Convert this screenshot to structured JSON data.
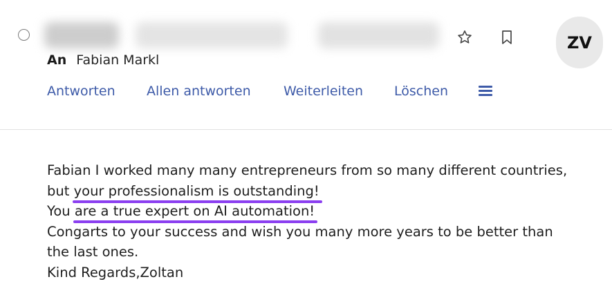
{
  "message": {
    "to_label": "An",
    "to_name": "Fabian Markl",
    "avatar_initials": "ZV",
    "icons": {
      "select": "select-circle-icon",
      "flag": "star-icon",
      "bookmark": "bookmark-icon",
      "more": "menu-icon"
    }
  },
  "actions": {
    "reply": "Antworten",
    "reply_all": "Allen antworten",
    "forward": "Weiterleiten",
    "delete": "Löschen"
  },
  "body": {
    "line1": "Fabian I worked many many entrepreneurs from so many different countries,",
    "line2_prefix": "but ",
    "line2_highlight": "your professionalism is outstanding!",
    "line3_prefix": "You ",
    "line3_highlight": "are a true expert on AI automation!",
    "line4": "Congarts to your success and wish you many more years to be better than",
    "line5": "the last ones.",
    "line6": "Kind Regards,Zoltan"
  },
  "highlight_color": "#8b3ff0",
  "accent_color": "#3d5aa8"
}
